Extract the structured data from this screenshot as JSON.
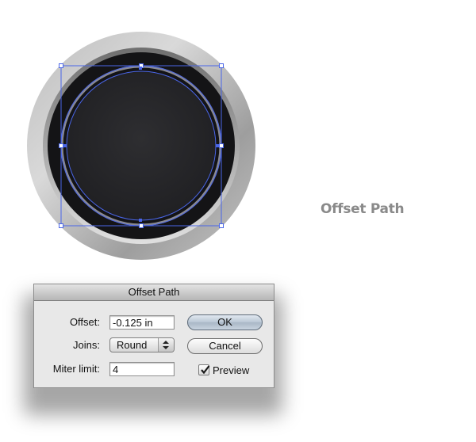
{
  "side_caption": "Offset Path",
  "dialog": {
    "title": "Offset Path",
    "offset_label": "Offset:",
    "offset_value": "-0.125 in",
    "joins_label": "Joins:",
    "joins_value": "Round",
    "miter_label": "Miter limit:",
    "miter_value": "4",
    "ok_label": "OK",
    "cancel_label": "Cancel",
    "preview_label": "Preview",
    "preview_checked": true
  },
  "icons": {
    "select_arrows": "updown-arrows-icon",
    "checkbox": "checkmark-icon"
  },
  "colors": {
    "selection": "#4a66e8",
    "button_inner": "#28282b",
    "caption": "#8a8a8a"
  }
}
